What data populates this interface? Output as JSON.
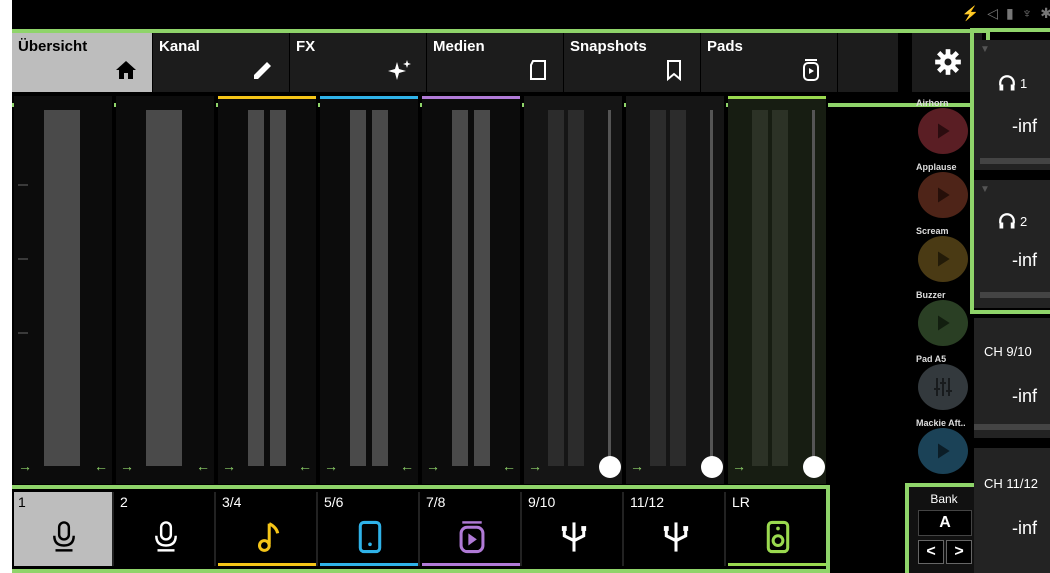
{
  "tabs": [
    {
      "label": "Übersicht",
      "icon": "home-icon"
    },
    {
      "label": "Kanal",
      "icon": "pencil-icon"
    },
    {
      "label": "FX",
      "icon": "sparkle-icon"
    },
    {
      "label": "Medien",
      "icon": "sd-card-icon"
    },
    {
      "label": "Snapshots",
      "icon": "bookmark-icon"
    },
    {
      "label": "Pads",
      "icon": "pad-icon"
    }
  ],
  "channels": [
    {
      "label": "1",
      "icon": "microphone-icon",
      "color": "#ffffff"
    },
    {
      "label": "2",
      "icon": "microphone-icon",
      "color": "#ffffff"
    },
    {
      "label": "3/4",
      "icon": "music-note-icon",
      "color": "#f5c518"
    },
    {
      "label": "5/6",
      "icon": "phone-icon",
      "color": "#2fb2e8"
    },
    {
      "label": "7/8",
      "icon": "media-player-icon",
      "color": "#b07ad6"
    },
    {
      "label": "9/10",
      "icon": "usb-icon",
      "color": "#ffffff"
    },
    {
      "label": "11/12",
      "icon": "usb-icon",
      "color": "#ffffff"
    },
    {
      "label": "LR",
      "icon": "speaker-icon",
      "color": "#9ad94f"
    }
  ],
  "pads": [
    {
      "label": "Airhorn",
      "color": "#5a1e24"
    },
    {
      "label": "Applause",
      "color": "#4e2418"
    },
    {
      "label": "Scream",
      "color": "#4a3a14"
    },
    {
      "label": "Buzzer",
      "color": "#2a3f24"
    },
    {
      "label": "Pad A5",
      "color": "#33393d"
    },
    {
      "label": "Mackie Aft..",
      "color": "#1b4257"
    }
  ],
  "right_panel": [
    {
      "name": "1",
      "val": "-inf",
      "icon": "headphones-icon"
    },
    {
      "name": "2",
      "val": "-inf",
      "icon": "headphones-icon"
    },
    {
      "name": "CH 9/10",
      "val": "-inf"
    },
    {
      "name": "CH 11/12",
      "val": "-inf"
    }
  ],
  "bank": {
    "label": "Bank",
    "value": "A",
    "prev": "<",
    "next": ">"
  }
}
